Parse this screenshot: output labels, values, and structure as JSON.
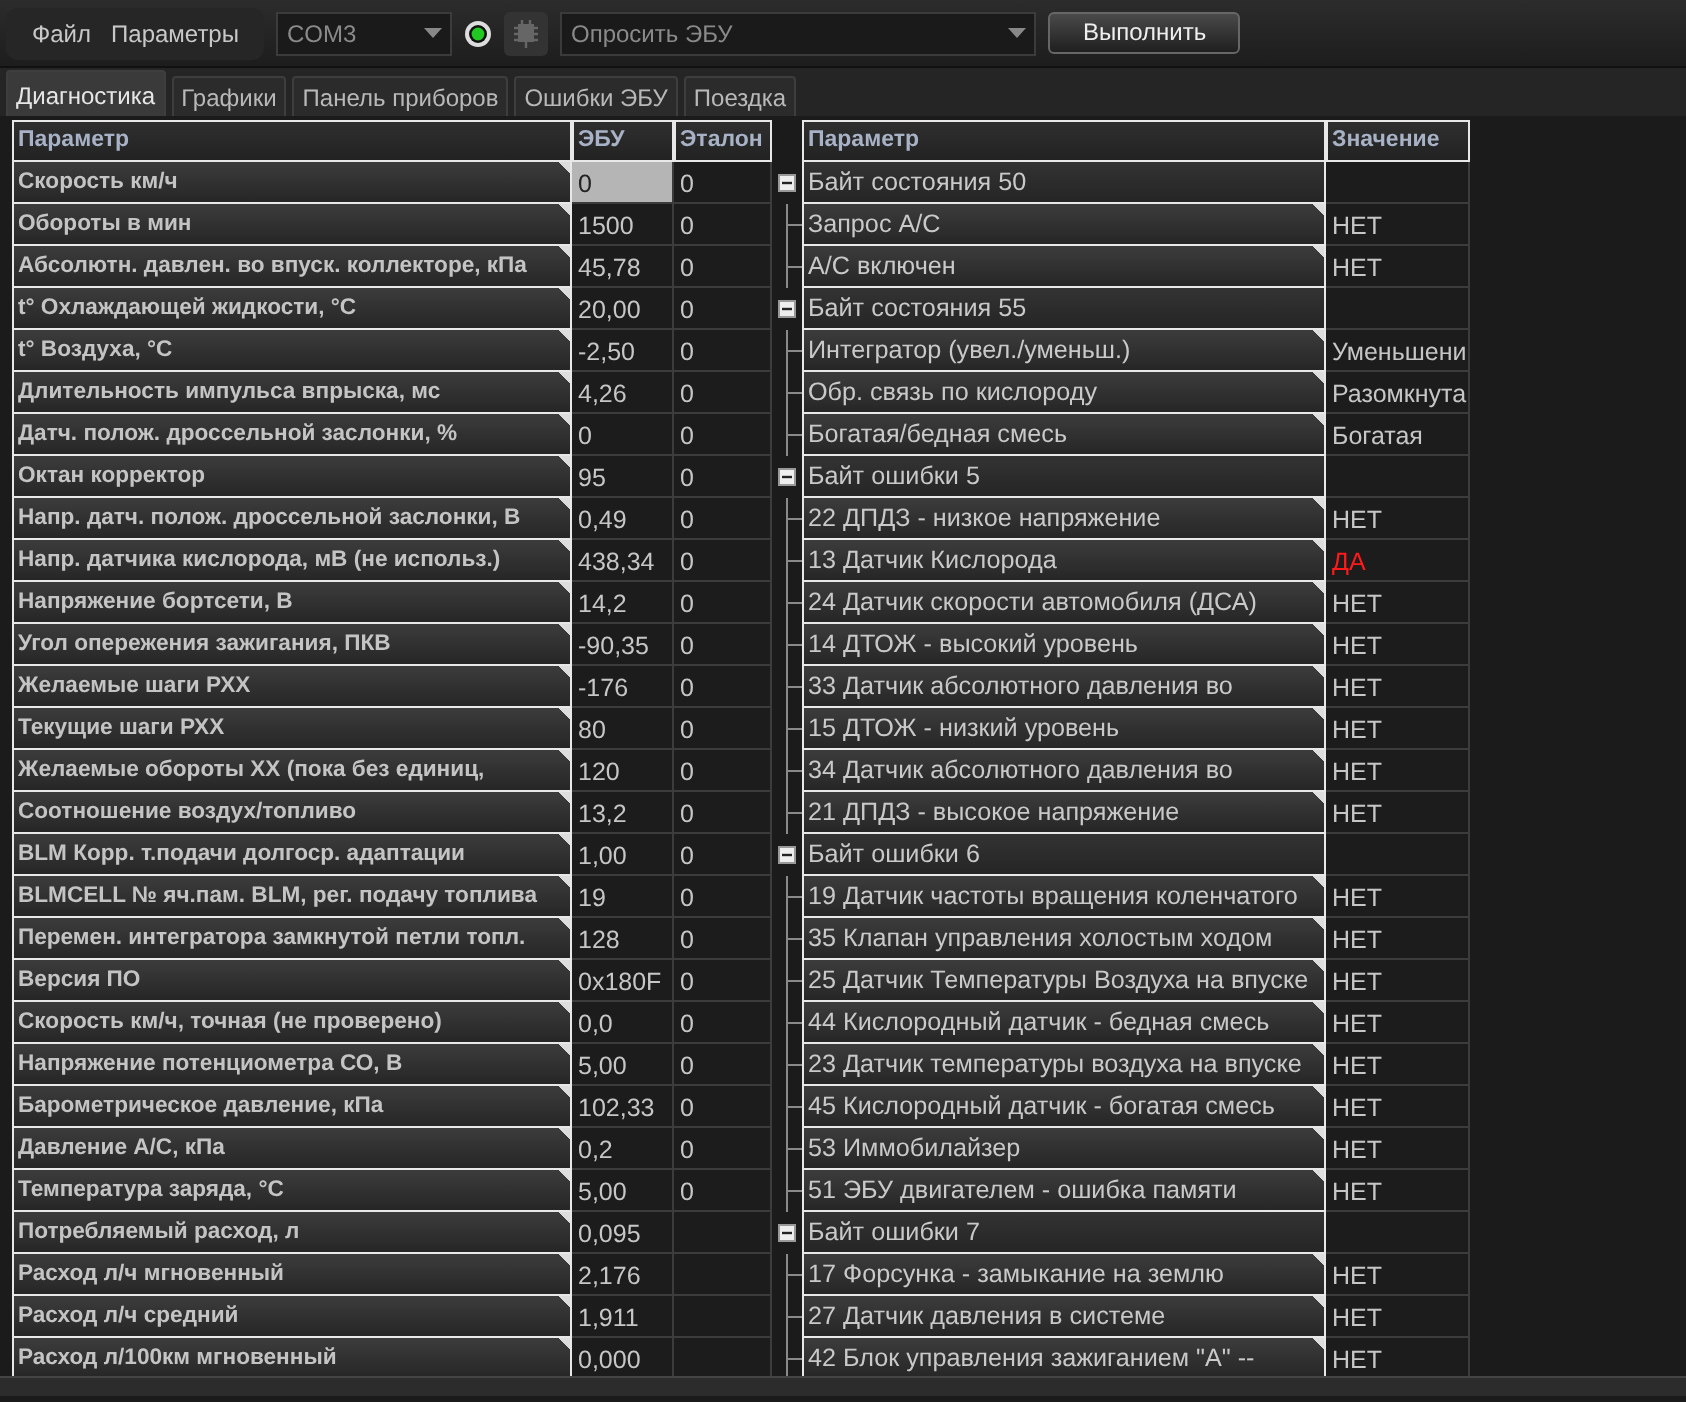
{
  "menu": [
    {
      "label": "Файл"
    },
    {
      "label": "Параметры"
    }
  ],
  "toolbar": {
    "port": "COM3",
    "connected": true,
    "action": "Опросить ЭБУ",
    "run_button": "Выполнить"
  },
  "tabs": [
    {
      "label": "Диагностика",
      "selected": true
    },
    {
      "label": "Графики",
      "selected": false
    },
    {
      "label": "Панель приборов",
      "selected": false
    },
    {
      "label": "Ошибки ЭБУ",
      "selected": false
    },
    {
      "label": "Поездка",
      "selected": false
    }
  ],
  "params_table": {
    "columns": [
      "Параметр",
      "ЭБУ",
      "Эталон"
    ],
    "rows": [
      {
        "parameter": "Скорость км/ч",
        "ecu": "0",
        "reference": "0",
        "selected": true
      },
      {
        "parameter": "Обороты в мин",
        "ecu": "1500",
        "reference": "0",
        "selected": false
      },
      {
        "parameter": "Абсолютн. давлен. во впуск. коллекторе, кПа",
        "ecu": "45,78",
        "reference": "0",
        "selected": false
      },
      {
        "parameter": "t° Охлаждающей жидкости, °C",
        "ecu": "20,00",
        "reference": "0",
        "selected": false
      },
      {
        "parameter": "t° Воздуха, °C",
        "ecu": "-2,50",
        "reference": "0",
        "selected": false
      },
      {
        "parameter": "Длительность импульса впрыска, мс",
        "ecu": "4,26",
        "reference": "0",
        "selected": false
      },
      {
        "parameter": "Датч. полож. дроссельной заслонки, %",
        "ecu": "0",
        "reference": "0",
        "selected": false
      },
      {
        "parameter": "Октан корректор",
        "ecu": "95",
        "reference": "0",
        "selected": false
      },
      {
        "parameter": "Напр. датч. полож. дроссельной заслонки, В",
        "ecu": "0,49",
        "reference": "0",
        "selected": false
      },
      {
        "parameter": "Напр. датчика кислорода, мВ (не использ.)",
        "ecu": "438,34",
        "reference": "0",
        "selected": false
      },
      {
        "parameter": "Напряжение бортсети, В",
        "ecu": "14,2",
        "reference": "0",
        "selected": false
      },
      {
        "parameter": "Угол опережения зажигания, ПКВ",
        "ecu": "-90,35",
        "reference": "0",
        "selected": false
      },
      {
        "parameter": "Желаемые шаги РХХ",
        "ecu": "-176",
        "reference": "0",
        "selected": false
      },
      {
        "parameter": "Текущие шаги РХХ",
        "ecu": "80",
        "reference": "0",
        "selected": false
      },
      {
        "parameter": "Желаемые обороты ХХ (пока без единиц,",
        "ecu": "120",
        "reference": "0",
        "selected": false
      },
      {
        "parameter": "Соотношение воздух/топливо",
        "ecu": "13,2",
        "reference": "0",
        "selected": false
      },
      {
        "parameter": "BLM Корр. т.подачи долгоср. адаптации",
        "ecu": "1,00",
        "reference": "0",
        "selected": false
      },
      {
        "parameter": "BLMCELL № яч.пам. BLM, рег. подачу топлива",
        "ecu": "19",
        "reference": "0",
        "selected": false
      },
      {
        "parameter": "Перемен. интегратора замкнутой петли топл.",
        "ecu": "128",
        "reference": "0",
        "selected": false
      },
      {
        "parameter": "Версия ПО",
        "ecu": "0x180F",
        "reference": "0",
        "selected": false
      },
      {
        "parameter": "Скорость км/ч, точная (не проверено)",
        "ecu": "0,0",
        "reference": "0",
        "selected": false
      },
      {
        "parameter": "Напряжение потенциометра СО, В",
        "ecu": "5,00",
        "reference": "0",
        "selected": false
      },
      {
        "parameter": "Барометрическое давление, кПа",
        "ecu": "102,33",
        "reference": "0",
        "selected": false
      },
      {
        "parameter": "Давление А/С, кПа",
        "ecu": "0,2",
        "reference": "0",
        "selected": false
      },
      {
        "parameter": "Температура заряда, °C",
        "ecu": "5,00",
        "reference": "0",
        "selected": false
      },
      {
        "parameter": "Потребляемый расход, л",
        "ecu": "0,095",
        "selected": false
      },
      {
        "parameter": "Расход л/ч мгновенный",
        "ecu": "2,176",
        "selected": false
      },
      {
        "parameter": "Расход л/ч средний",
        "ecu": "1,911",
        "selected": false
      },
      {
        "parameter": "Расход л/100км мгновенный",
        "ecu": "0,000",
        "selected": false
      }
    ]
  },
  "status_table": {
    "columns": [
      "Параметр",
      "Значение"
    ],
    "groups": [
      {
        "label": "Байт состояния 50",
        "expanded": true,
        "children": [
          {
            "label": "Запрос А/С",
            "value": "НЕТ",
            "alarm": false
          },
          {
            "label": "А/С включен",
            "value": "НЕТ",
            "alarm": false
          }
        ]
      },
      {
        "label": "Байт состояния 55",
        "expanded": true,
        "children": [
          {
            "label": "Интегратор (увел./уменьш.)",
            "value": "Уменьшени",
            "alarm": false
          },
          {
            "label": "Обр. связь по кислороду",
            "value": "Разомкнута",
            "alarm": false
          },
          {
            "label": "Богатая/бедная смесь",
            "value": "Богатая",
            "alarm": false
          }
        ]
      },
      {
        "label": "Байт ошибки 5",
        "expanded": true,
        "children": [
          {
            "label": "22 ДПДЗ - низкое напряжение",
            "value": "НЕТ",
            "alarm": false
          },
          {
            "label": "13 Датчик Кислорода",
            "value": "ДА",
            "alarm": true
          },
          {
            "label": "24 Датчик скорости автомобиля (ДСА)",
            "value": "НЕТ",
            "alarm": false
          },
          {
            "label": "14 ДТОЖ - высокий уровень",
            "value": "НЕТ",
            "alarm": false
          },
          {
            "label": "33 Датчик абсолютного давления во",
            "value": "НЕТ",
            "alarm": false
          },
          {
            "label": "15 ДТОЖ - низкий уровень",
            "value": "НЕТ",
            "alarm": false
          },
          {
            "label": "34 Датчик абсолютного давления во",
            "value": "НЕТ",
            "alarm": false
          },
          {
            "label": "21 ДПДЗ - высокое напряжение",
            "value": "НЕТ",
            "alarm": false
          }
        ]
      },
      {
        "label": "Байт ошибки 6",
        "expanded": true,
        "children": [
          {
            "label": "19 Датчик частоты вращения коленчатого",
            "value": "НЕТ",
            "alarm": false
          },
          {
            "label": "35 Клапан управления холостым ходом",
            "value": "НЕТ",
            "alarm": false
          },
          {
            "label": "25 Датчик Температуры Воздуха на впуске",
            "value": "НЕТ",
            "alarm": false
          },
          {
            "label": "44 Кислородный датчик - бедная смесь",
            "value": "НЕТ",
            "alarm": false
          },
          {
            "label": "23 Датчик температуры воздуха на впуске",
            "value": "НЕТ",
            "alarm": false
          },
          {
            "label": "45 Кислородный датчик - богатая смесь",
            "value": "НЕТ",
            "alarm": false
          },
          {
            "label": "53 Иммобилайзер",
            "value": "НЕТ",
            "alarm": false
          },
          {
            "label": "51 ЭБУ двигателем - ошибка памяти",
            "value": "НЕТ",
            "alarm": false
          }
        ]
      },
      {
        "label": "Байт ошибки 7",
        "expanded": true,
        "children": [
          {
            "label": "17 Форсунка - замыкание на землю",
            "value": "НЕТ",
            "alarm": false
          },
          {
            "label": "27 Датчик давления в системе",
            "value": "НЕТ",
            "alarm": false
          },
          {
            "label": "42 Блок управления зажиганием \"А\" --",
            "value": "НЕТ",
            "alarm": false
          }
        ]
      }
    ]
  }
}
